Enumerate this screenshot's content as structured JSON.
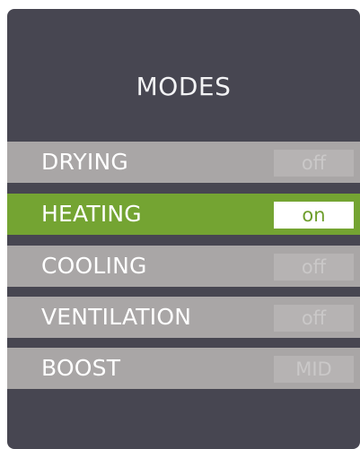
{
  "panel": {
    "title": "MODES",
    "modes": [
      {
        "label": "DRYING",
        "value": "off",
        "active": false
      },
      {
        "label": "HEATING",
        "value": "on",
        "active": true
      },
      {
        "label": "COOLING",
        "value": "off",
        "active": false
      },
      {
        "label": "VENTILATION",
        "value": "off",
        "active": false
      },
      {
        "label": "BOOST",
        "value": "MID",
        "active": false
      }
    ]
  },
  "colors": {
    "panel_background": "#474651",
    "row_inactive": "#a9a6a6",
    "row_active": "#74a432",
    "toggle_inactive": "#b6b3b3",
    "toggle_active": "#ffffff"
  }
}
